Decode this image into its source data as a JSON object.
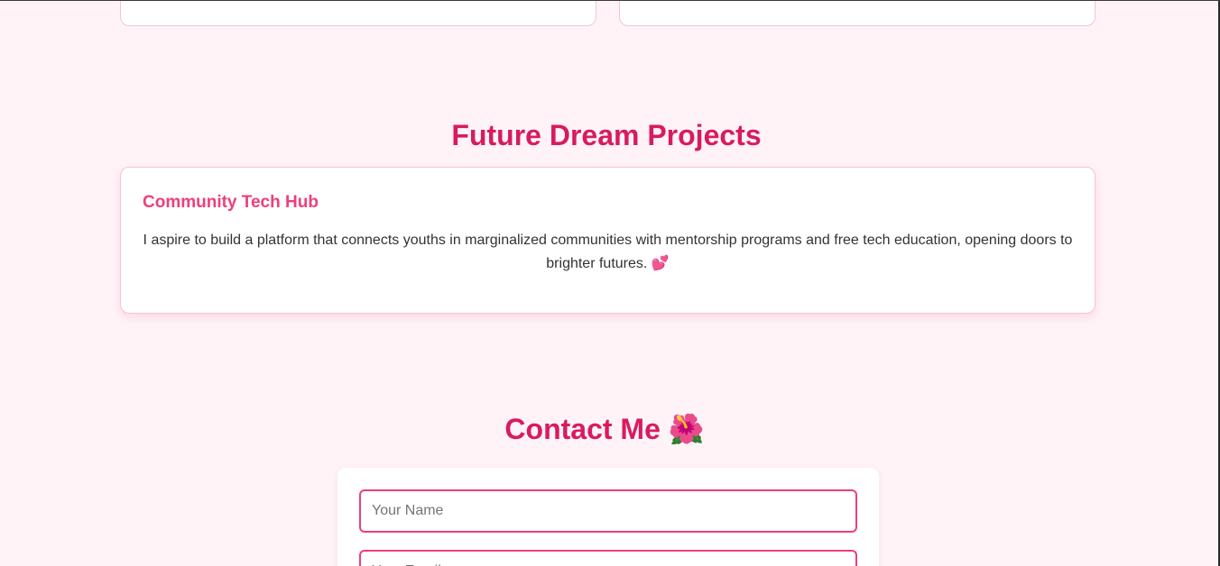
{
  "future_section": {
    "title": "Future Dream Projects",
    "project": {
      "title": "Community Tech Hub",
      "description": "I aspire to build a platform that connects youths in marginalized communities with mentorship programs and free tech education, opening doors to brighter futures.",
      "emoji": "💕"
    }
  },
  "contact_section": {
    "title": "Contact Me",
    "emoji": "🌺",
    "name_placeholder": "Your Name",
    "email_placeholder": "Your Email"
  },
  "colors": {
    "page_background": "#fff3f7",
    "heading": "#d81b60",
    "accent": "#ec407a",
    "card_border": "#f1c6d8"
  }
}
